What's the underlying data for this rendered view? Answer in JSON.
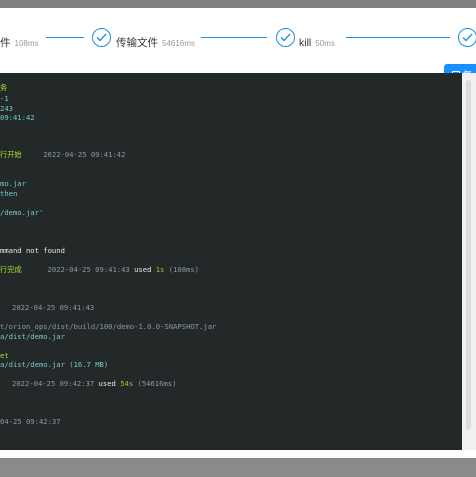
{
  "steps": [
    {
      "label": "件",
      "duration": "108ms"
    },
    {
      "label": "传输文件",
      "duration": "54616ms"
    },
    {
      "label": "kill",
      "duration": "50ms"
    }
  ],
  "action_button": {
    "label": "复"
  },
  "terminal": {
    "lines": {
      "l1": "",
      "l2": "-1",
      "l3": "243",
      "l4": "09:41:42",
      "l5_a": "行开始",
      "l5_b": "2022-04-25 09:41:42",
      "l6": "mo.jar",
      "l7": "then",
      "l8": "/demo.jar'",
      "l9": "mmand not found",
      "l10_a": "行完成",
      "l10_b": "2022-04-25 09:41:43",
      "l10_c": "used",
      "l10_d": "1s",
      "l10_e": "(108ms)",
      "l11": "2022-04-25 09:41:43",
      "l12": "t/orion_ops/dist/build/100/demo-1.0.0-SNAPSHOT.jar",
      "l13": "a/dist/demo.jar",
      "l14": "et",
      "l15": "a/dist/demo.jar (16.7 MB)",
      "l16_a": "2022-04-25 09:42:37",
      "l16_b": "used",
      "l16_c": "54s",
      "l16_d": "(54616ms)",
      "l17": "04-25 09:42:37"
    }
  }
}
